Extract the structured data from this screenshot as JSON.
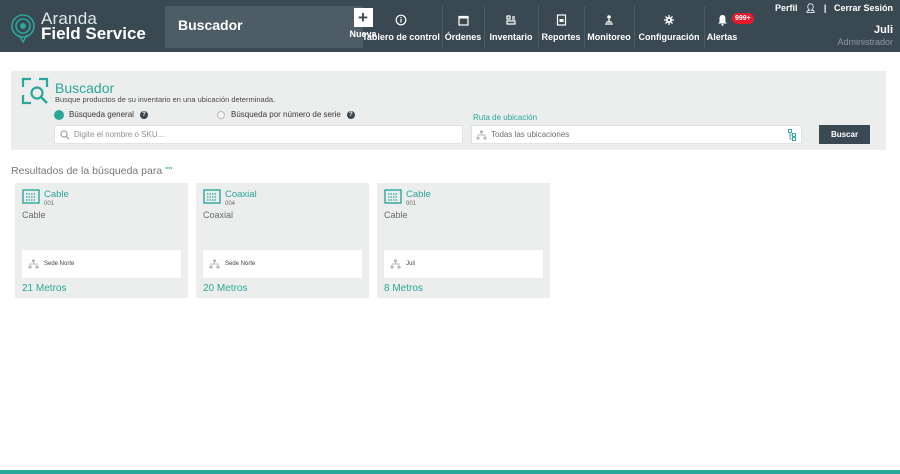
{
  "brand": {
    "line1": "Aranda",
    "line2": "Field Service"
  },
  "header": {
    "section_title": "Buscador"
  },
  "nav": {
    "items": [
      {
        "label": "Nueva",
        "icon": "plus-icon"
      },
      {
        "label": "Tablero de control",
        "icon": "info-circle-icon"
      },
      {
        "label": "Órdenes",
        "icon": "calendar-icon"
      },
      {
        "label": "Inventario",
        "icon": "inventory-icon"
      },
      {
        "label": "Reportes",
        "icon": "report-icon"
      },
      {
        "label": "Monitoreo",
        "icon": "monitor-icon"
      },
      {
        "label": "Configuración",
        "icon": "gear-icon"
      },
      {
        "label": "Alertas",
        "icon": "bell-icon"
      }
    ],
    "alerts_badge": "999+"
  },
  "user": {
    "profile_label": "Perfil",
    "logout_label": "Cerrar Sesión",
    "name": "Juli",
    "role": "Administrador"
  },
  "search": {
    "title": "Buscador",
    "subtitle": "Busque productos de su inventario en una ubicación determinada.",
    "radio_general": "Búsqueda general",
    "radio_serial": "Búsqueda por número de serie",
    "sku_placeholder": "Digite el nombre o SKU...",
    "route_label": "Ruta de ubicación",
    "route_placeholder": "Todas las ubicaciones",
    "search_button": "Buscar"
  },
  "results": {
    "title": "Resultados de la búsqueda para",
    "query": "\"\"",
    "items": [
      {
        "name": "Cable",
        "code": "001",
        "type": "Cable",
        "location": "Sede Norte",
        "quantity": "21 Metros"
      },
      {
        "name": "Coaxial",
        "code": "004",
        "type": "Coaxial",
        "location": "Sede Norte",
        "quantity": "20 Metros"
      },
      {
        "name": "Cable",
        "code": "001",
        "type": "Cable",
        "location": "Juli",
        "quantity": "8 Metros"
      }
    ]
  },
  "colors": {
    "accent": "#2aa79b",
    "header_bg": "#3a4852",
    "badge": "#e5192c",
    "panel_bg": "#eceded"
  }
}
